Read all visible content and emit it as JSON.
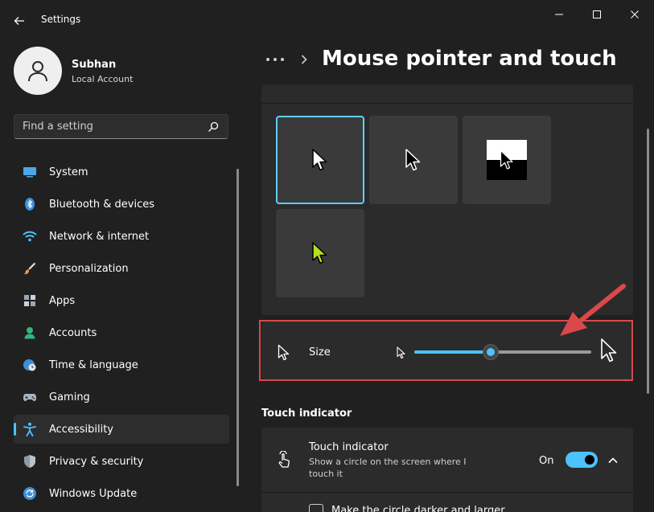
{
  "window": {
    "title": "Settings",
    "back_icon": "back-arrow-icon",
    "controls": [
      "minimize-icon",
      "maximize-icon",
      "close-icon"
    ]
  },
  "profile": {
    "name": "Subhan",
    "account": "Local Account",
    "avatar_icon": "person-icon"
  },
  "search": {
    "placeholder": "Find a setting",
    "value": "",
    "icon": "search-icon"
  },
  "sidebar": {
    "items": [
      {
        "label": "System",
        "icon": "monitor-icon",
        "active": false
      },
      {
        "label": "Bluetooth & devices",
        "icon": "bluetooth-icon",
        "active": false
      },
      {
        "label": "Network & internet",
        "icon": "wifi-icon",
        "active": false
      },
      {
        "label": "Personalization",
        "icon": "brush-icon",
        "active": false
      },
      {
        "label": "Apps",
        "icon": "apps-icon",
        "active": false
      },
      {
        "label": "Accounts",
        "icon": "account-icon",
        "active": false
      },
      {
        "label": "Time & language",
        "icon": "globe-clock-icon",
        "active": false
      },
      {
        "label": "Gaming",
        "icon": "gamepad-icon",
        "active": false
      },
      {
        "label": "Accessibility",
        "icon": "accessibility-icon",
        "active": true
      },
      {
        "label": "Privacy & security",
        "icon": "shield-icon",
        "active": false
      },
      {
        "label": "Windows Update",
        "icon": "update-icon",
        "active": false
      }
    ]
  },
  "header": {
    "breadcrumb_more_icon": "more-icon",
    "breadcrumb_separator_icon": "chevron-right-icon",
    "title": "Mouse pointer and touch"
  },
  "pointer_styles": {
    "selected": "white",
    "options": [
      "white",
      "black",
      "inverted",
      "custom"
    ],
    "custom_color": "#b6e01e"
  },
  "size": {
    "label": "Size",
    "value_fraction": 0.43
  },
  "touch": {
    "section_heading": "Touch indicator",
    "title": "Touch indicator",
    "description": "Show a circle on the screen where I touch it",
    "toggle_state": "On",
    "toggle_on": true,
    "sub_option_label": "Make the circle darker and larger"
  },
  "colors": {
    "accent": "#4cc2ff",
    "annotation": "#d9484b"
  }
}
